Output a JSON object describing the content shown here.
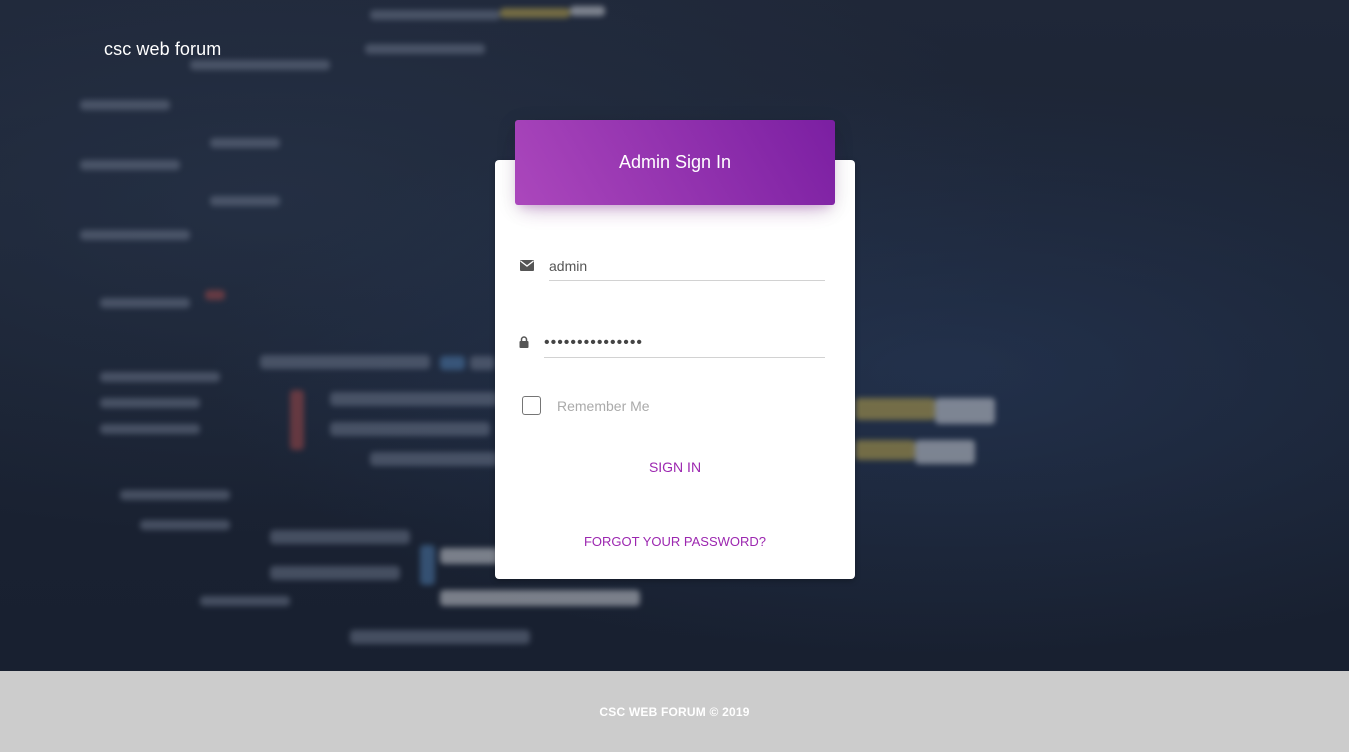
{
  "brand": {
    "title": "csc web forum"
  },
  "login_card": {
    "header_title": "Admin Sign In",
    "email_value": "admin",
    "password_value": "•••••••••••••••",
    "remember_label": "Remember Me",
    "signin_label": "SIGN IN",
    "forgot_label": "FORGOT YOUR PASSWORD?",
    "icons": {
      "email": "envelope-icon",
      "password": "lock-icon"
    },
    "accent_color": "#9c27b0"
  },
  "footer": {
    "text": "CSC WEB FORUM © 2019"
  }
}
